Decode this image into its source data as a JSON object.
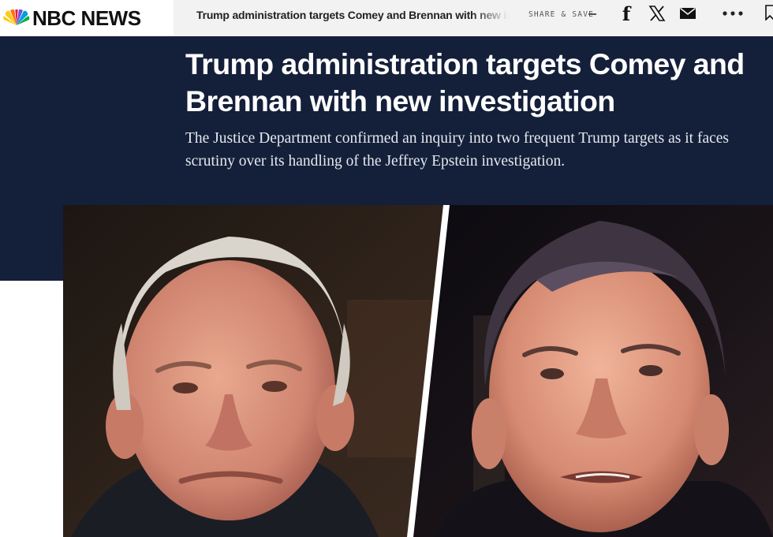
{
  "brand": {
    "name": "NBC NEWS",
    "logo_icon": "peacock-icon",
    "peacock_colors": [
      "#fccc12",
      "#ef1541",
      "#ff7112",
      "#6e55dc",
      "#069de0",
      "#05ac3f"
    ]
  },
  "topbar": {
    "headline": "Trump administration targets Comey and Brennan with new investigation",
    "share_label": "SHARE & SAVE",
    "icons": [
      "facebook-icon",
      "x-icon",
      "mail-icon",
      "more-icon",
      "bookmark-icon"
    ]
  },
  "article": {
    "headline": "Trump administration targets Comey and Brennan with new investigation",
    "dek": "The Justice Department confirmed an inquiry into two frequent Trump targets as it faces scrutiny over its handling of the Jeffrey Epstein investigation."
  },
  "colors": {
    "hero_background": "#14203a",
    "topbar_background": "#f2f2f2"
  }
}
